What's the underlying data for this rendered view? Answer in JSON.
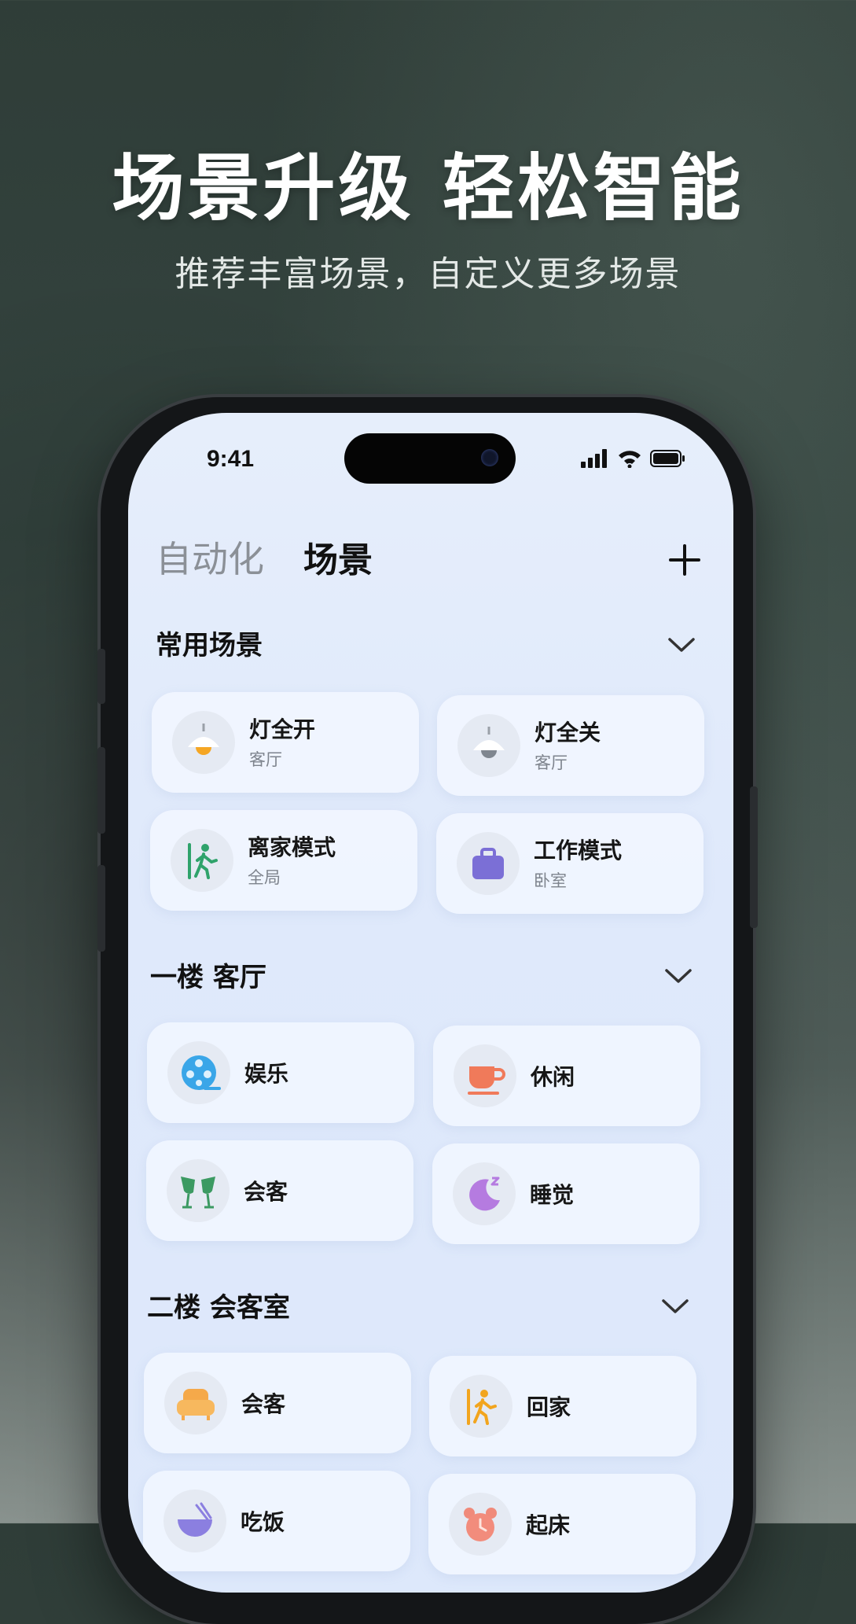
{
  "hero": {
    "title": "场景升级 轻松智能",
    "subtitle": "推荐丰富场景，自定义更多场景"
  },
  "status_bar": {
    "time": "9:41"
  },
  "tabs": {
    "automation": "自动化",
    "scenes": "场景"
  },
  "sections": [
    {
      "title": "常用场景",
      "cards": [
        {
          "name": "灯全开",
          "sub": "客厅",
          "icon": "lamp-on-icon"
        },
        {
          "name": "灯全关",
          "sub": "客厅",
          "icon": "lamp-off-icon"
        },
        {
          "name": "离家模式",
          "sub": "全局",
          "icon": "leave-home-icon"
        },
        {
          "name": "工作模式",
          "sub": "卧室",
          "icon": "briefcase-icon"
        }
      ]
    },
    {
      "title": "一楼 客厅",
      "cards": [
        {
          "name": "娱乐",
          "icon": "film-reel-icon"
        },
        {
          "name": "休闲",
          "icon": "coffee-cup-icon"
        },
        {
          "name": "会客",
          "icon": "wine-glasses-icon"
        },
        {
          "name": "睡觉",
          "icon": "moon-sleep-icon"
        }
      ]
    },
    {
      "title": "二楼 会客室",
      "cards": [
        {
          "name": "会客",
          "icon": "sofa-icon"
        },
        {
          "name": "回家",
          "icon": "come-home-icon"
        },
        {
          "name": "吃饭",
          "icon": "bowl-icon"
        },
        {
          "name": "起床",
          "icon": "alarm-clock-icon"
        }
      ]
    }
  ],
  "colors": {
    "background": "#34443f",
    "screen": "#e3ecfb",
    "lamp_on": "#f5a623",
    "leave_green": "#2fa36b",
    "work_purple": "#7b6fd6",
    "film_blue": "#3aa6e8",
    "coffee_orange": "#f07a5a",
    "glass_green": "#3c9a62",
    "moon_purple": "#b57be0",
    "sofa_orange": "#f5a94a"
  }
}
